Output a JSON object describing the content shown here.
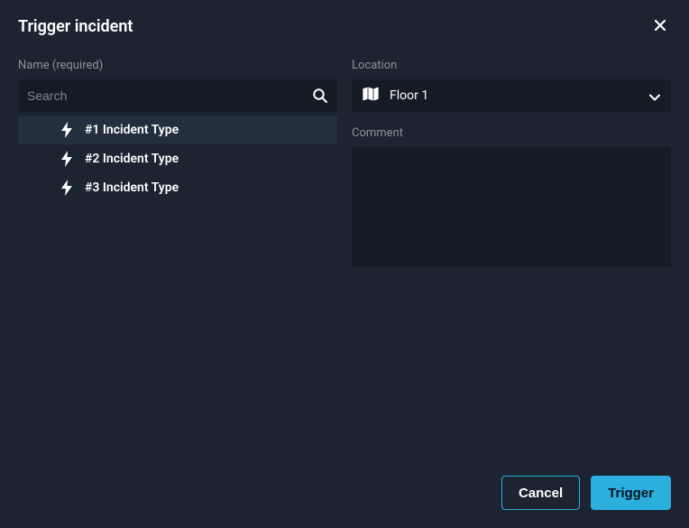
{
  "dialog": {
    "title": "Trigger incident"
  },
  "nameField": {
    "label": "Name (required)",
    "searchPlaceholder": "Search",
    "items": [
      {
        "label": "#1 Incident Type",
        "selected": true
      },
      {
        "label": "#2 Incident Type",
        "selected": false
      },
      {
        "label": "#3 Incident Type",
        "selected": false
      }
    ]
  },
  "locationField": {
    "label": "Location",
    "selected": "Floor 1"
  },
  "commentField": {
    "label": "Comment",
    "value": ""
  },
  "footer": {
    "cancel": "Cancel",
    "trigger": "Trigger"
  }
}
